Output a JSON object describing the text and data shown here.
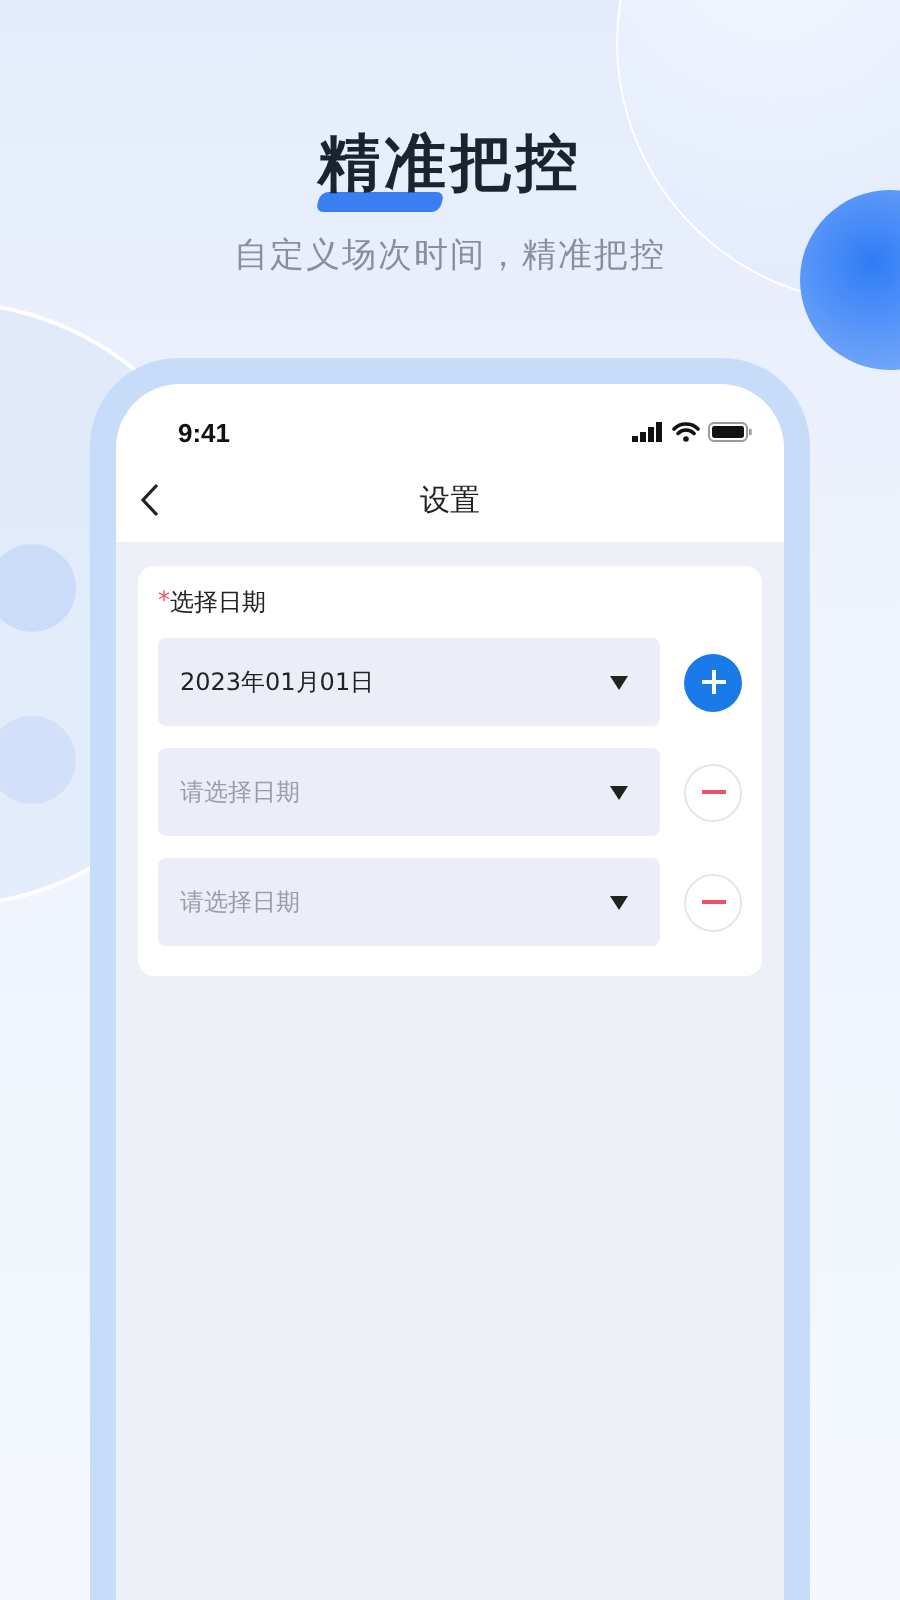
{
  "headline": {
    "title": "精准把控",
    "subtitle": "自定义场次时间，精准把控"
  },
  "status_bar": {
    "time": "9:41"
  },
  "nav": {
    "title": "设置"
  },
  "form": {
    "required_mark": "*",
    "label": "选择日期",
    "rows": [
      {
        "kind": "value",
        "text": "2023年01月01日",
        "button": {
          "kind": "add"
        }
      },
      {
        "kind": "placeholder",
        "text": "请选择日期",
        "button": {
          "kind": "remove"
        }
      },
      {
        "kind": "placeholder",
        "text": "请选择日期",
        "button": {
          "kind": "remove"
        }
      }
    ]
  }
}
